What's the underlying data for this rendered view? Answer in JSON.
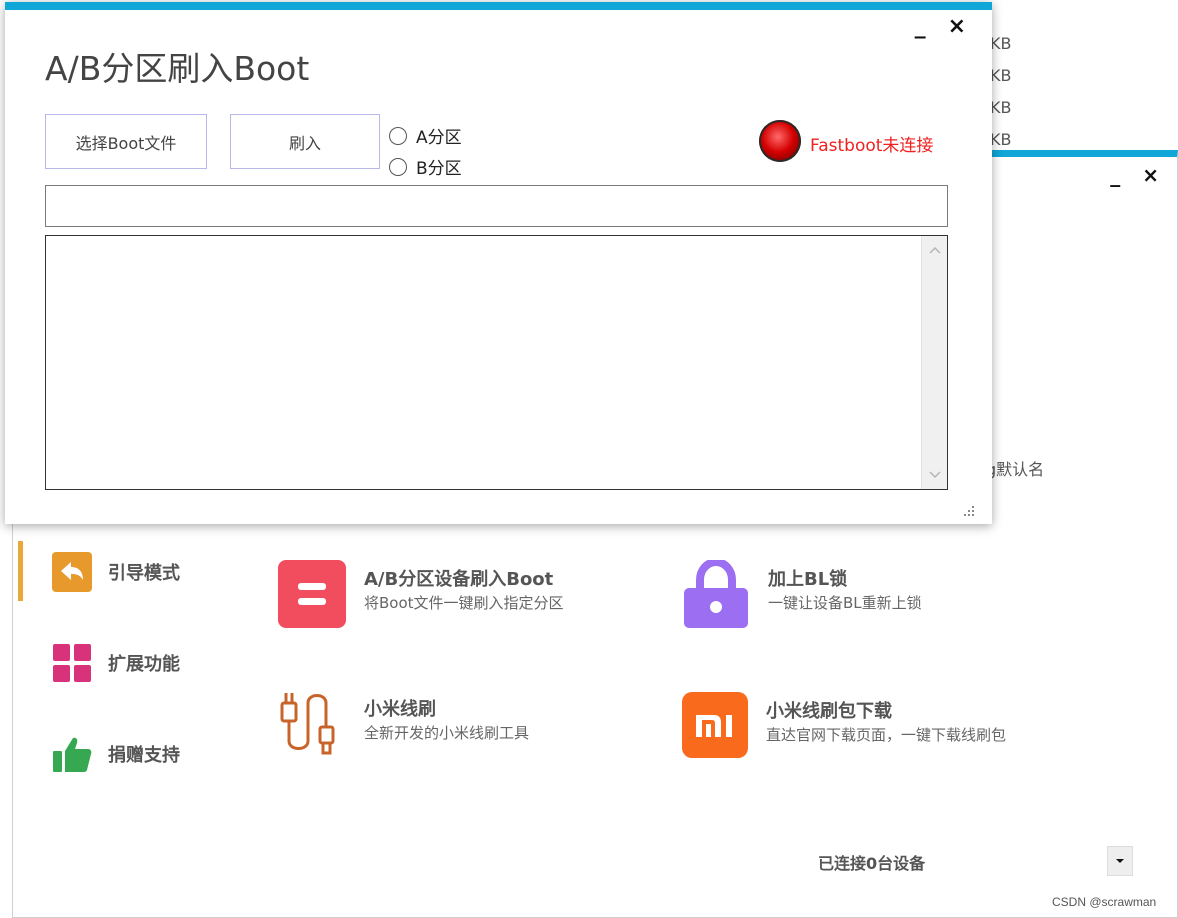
{
  "main_window": {
    "minimize_label": "_",
    "close_label": "×",
    "behind_sizes": [
      "KB",
      "KB",
      "KB",
      "KB"
    ],
    "behind_text": "g默认名",
    "nav": [
      {
        "label": "引导模式",
        "icon": "back-arrow-icon",
        "color": "#e8992b"
      },
      {
        "label": "扩展功能",
        "icon": "grid-icon",
        "color": "#d8327a"
      },
      {
        "label": "捐赠支持",
        "icon": "thumbs-up-icon",
        "color": "#36a852"
      }
    ],
    "features": [
      {
        "title": "A/B分区设备刷入Boot",
        "desc": "将Boot文件一键刷入指定分区",
        "icon": "boot-flash-icon",
        "color": "#f24d5f"
      },
      {
        "title": "加上BL锁",
        "desc": "一键让设备BL重新上锁",
        "icon": "lock-icon",
        "color": "#9b6ef2"
      },
      {
        "title": "小米线刷",
        "desc": "全新开发的小米线刷工具",
        "icon": "usb-cable-icon",
        "color": "#c8642a"
      },
      {
        "title": "小米线刷包下载",
        "desc": "直达官网下载页面，一键下载线刷包",
        "icon": "mi-logo-icon",
        "color": "#fa6a1c"
      }
    ],
    "connected_status": "已连接0台设备",
    "watermark": "CSDN @scrawman"
  },
  "dialog": {
    "title": "A/B分区刷入Boot",
    "minimize_label": "_",
    "close_label": "×",
    "select_button": "选择Boot文件",
    "flash_button": "刷入",
    "radio_a": "A分区",
    "radio_b": "B分区",
    "fastboot_status": "Fastboot未连接",
    "path_value": "",
    "log_value": ""
  },
  "colors": {
    "accent": "#10a6d8",
    "error": "#f02020"
  }
}
